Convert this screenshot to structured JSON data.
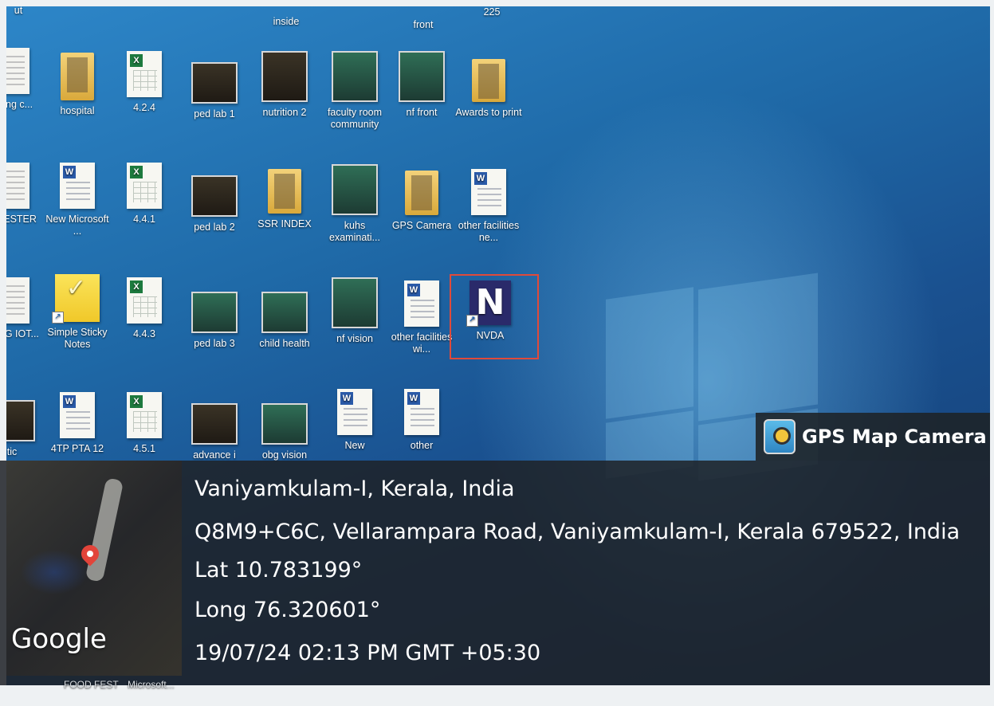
{
  "desktop": {
    "partial_top_labels": [
      "ut",
      "inside",
      "front",
      "225"
    ],
    "row1": [
      "hospital",
      "4.2.4",
      "ped lab 1",
      "nutrition 2",
      "faculty room community",
      "nf front",
      "Awards to print"
    ],
    "row1_partial_left": "ort ng c...",
    "row2": [
      "New Microsoft ...",
      "4.4.1",
      "ped lab 2",
      "SSR INDEX",
      "kuhs examinati...",
      "GPS Camera",
      "other facilities ne..."
    ],
    "row2_partial_left": "TH ESTER",
    "row3": [
      "Simple Sticky Notes",
      "4.4.3",
      "ped lab 3",
      "child health",
      "nf vision",
      "other facilities wi...",
      "NVDA"
    ],
    "row3_partial_left": "OTAG IOT...",
    "row4": [
      "4TP PTA 12",
      "4.5.1",
      "advance i",
      "obg vision",
      "New",
      "other"
    ],
    "row4_partial_left": "tic",
    "bottom_partial": [
      "FOOD FEST",
      "Microsoft..."
    ],
    "nvda_glyph": "N"
  },
  "gps": {
    "app_name": "GPS Map Camera",
    "location_title": "Vaniyamkulam-I, Kerala, India",
    "address": "Q8M9+C6C, Vellarampara Road, Vaniyamkulam-I, Kerala 679522, India",
    "lat": "Lat 10.783199°",
    "long": "Long 76.320601°",
    "datetime": "19/07/24 02:13 PM GMT +05:30",
    "map_brand": "Google"
  },
  "colors": {
    "desktop_blue": "#1f6aa8",
    "selection": "#e04a3a",
    "overlay": "#1e2226",
    "pin": "#e2443a"
  },
  "icons": [
    "folder-icon",
    "excel-icon",
    "photo-icon",
    "word-icon",
    "sticky-notes-icon",
    "nvda-icon",
    "map-pin-icon",
    "gps-camera-app-icon"
  ]
}
